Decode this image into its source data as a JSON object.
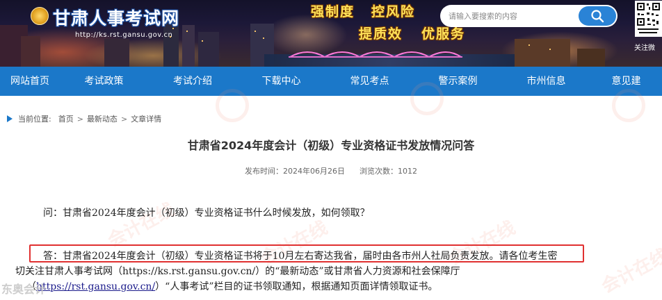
{
  "header": {
    "site_title": "甘肃人事考试网",
    "site_url": "http://ks.rst.gansu.gov.cn",
    "slogans": [
      "强制度",
      "控风险",
      "提质效",
      "优服务"
    ],
    "search_placeholder": "请输入要搜索的内容",
    "qr_caption": "关注微",
    "search_icon": "search-icon"
  },
  "nav": {
    "items": [
      "网站首页",
      "考试政策",
      "考试介绍",
      "下载中心",
      "常见考点",
      "警示案例",
      "市州信息",
      "意见建"
    ]
  },
  "breadcrumb": {
    "label": "当前位置:",
    "items": [
      "首页",
      "最新动态",
      "文章详情"
    ],
    "separator": ">"
  },
  "article": {
    "title": "甘肃省2024年度会计（初级）专业资格证书发放情况问答",
    "publish_label": "发布时间：2024年06月26日",
    "views_label": "浏览次数：1012",
    "question": "问：甘肃省2024年度会计（初级）专业资格证书什么时候发放，如何领取？",
    "answer_line1_highlighted": "答：甘肃省2024年度会计（初级）专业资格证书将于10月左右寄达我省，届时由各市州人社局负责发放。",
    "answer_line1_rest": "请各位考生密",
    "answer_line2": "切关注甘肃人事考试网（https://ks.rst.gansu.gov.cn/）的“最新动态”或甘肃省人力资源和社会保障厅",
    "answer_line3_prefix": "（",
    "answer_line3_link": "https://rst.gansu.gov.cn/",
    "answer_line3_suffix": "）“人事考试”栏目的证书领取通知，根据通知页面详情领取证书。"
  },
  "watermark": {
    "text": "会计在线",
    "corner": "东奥会计"
  },
  "colors": {
    "nav_bg": "#1b78c9",
    "highlight_border": "#e03030",
    "search_button": "#2a83d6",
    "slogan": "#ffe35a"
  }
}
